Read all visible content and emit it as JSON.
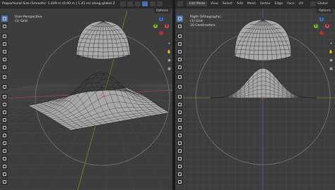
{
  "left_viewport": {
    "header_status": "Proportional Size (Smooth): 1.449 m  (0.00 m | 1.41 m) along global Z",
    "view_name": "User Perspective",
    "object_name": "(1) Grid",
    "options_label": "Options",
    "header_icons": [
      "view-icon",
      "select-icon",
      "overlay-icon",
      "shading-solid-icon",
      "shading-material-icon",
      "shading-render-icon"
    ]
  },
  "right_viewport": {
    "mode_label": "Edit Mode",
    "menu": [
      "View",
      "Select",
      "Add",
      "Mesh",
      "Vertex",
      "Edge",
      "Face",
      "UV"
    ],
    "transform_orientation": "Global",
    "view_name": "Right Orthographic",
    "object_name": "(1) Grid",
    "scale_info": "10 Centimeters",
    "options_label": "Options"
  },
  "toolbar_tools": [
    "select-box",
    "cursor",
    "move",
    "rotate",
    "scale",
    "transform",
    "annotate",
    "measure",
    "add-cube",
    "extrude",
    "inset",
    "bevel",
    "loop-cut",
    "knife",
    "poly-build",
    "spin",
    "smooth",
    "edge-slide",
    "shrink-fatten",
    "shear",
    "rip-region"
  ],
  "gizmo": {
    "x_label": "X",
    "y_label": "Y",
    "z_label": "Z",
    "colors": {
      "x": "#e94a5b",
      "y": "#7fbf3f",
      "z": "#3f7fd9"
    }
  },
  "colors": {
    "viewport_bg": "#3d3d3d",
    "grid_line": "#4a4a4a",
    "axis_red": "#a3444c",
    "axis_green": "#6a8a2e",
    "mesh_fill": "#a9a9a9",
    "mesh_wire": "#222222",
    "active_tool": "#4772b3"
  }
}
